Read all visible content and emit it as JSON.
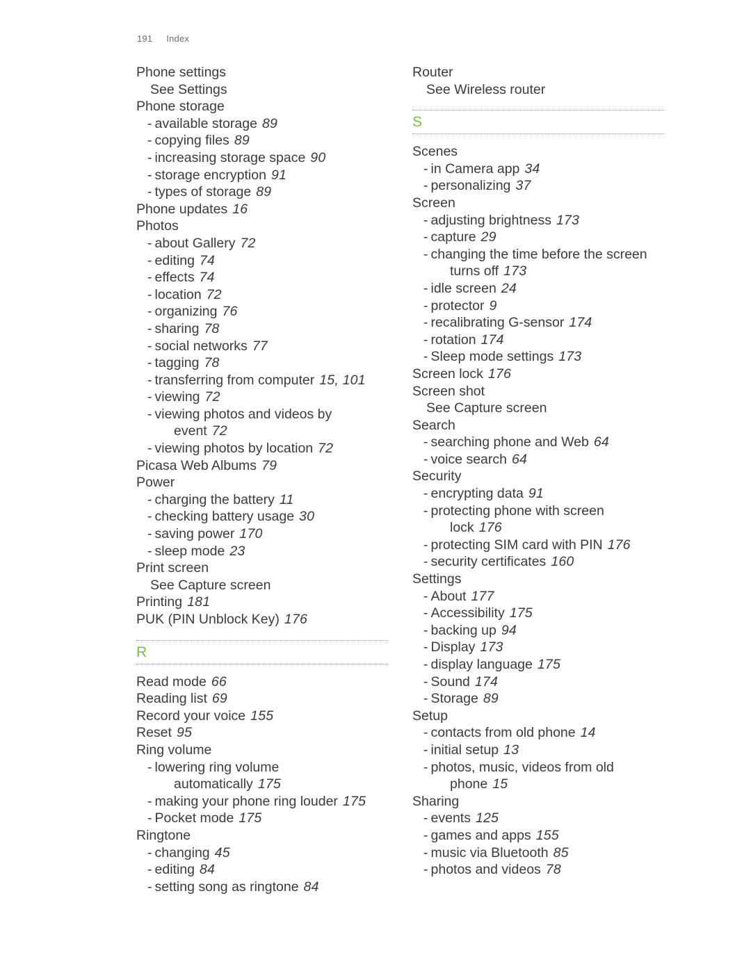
{
  "header": {
    "folio": "191",
    "title": "Index"
  },
  "colors": {
    "letter_green": "#78bf43",
    "text": "#3b3b3b",
    "header_text": "#6e6e6e",
    "rule": "#909090"
  },
  "left_column": [
    {
      "level": 0,
      "text": "Phone settings"
    },
    {
      "level": 2,
      "text": "See Settings"
    },
    {
      "level": 0,
      "text": "Phone storage"
    },
    {
      "level": 1,
      "text": "available storage",
      "page": "89"
    },
    {
      "level": 1,
      "text": "copying files",
      "page": "89"
    },
    {
      "level": 1,
      "text": "increasing storage space",
      "page": "90"
    },
    {
      "level": 1,
      "text": "storage encryption",
      "page": "91"
    },
    {
      "level": 1,
      "text": "types of storage",
      "page": "89"
    },
    {
      "level": 0,
      "text": "Phone updates",
      "page": "16"
    },
    {
      "level": 0,
      "text": "Photos"
    },
    {
      "level": 1,
      "text": "about Gallery",
      "page": "72"
    },
    {
      "level": 1,
      "text": "editing",
      "page": "74"
    },
    {
      "level": 1,
      "text": "effects",
      "page": "74"
    },
    {
      "level": 1,
      "text": "location",
      "page": "72"
    },
    {
      "level": 1,
      "text": "organizing",
      "page": "76"
    },
    {
      "level": 1,
      "text": "sharing",
      "page": "78"
    },
    {
      "level": 1,
      "text": "social networks",
      "page": "77"
    },
    {
      "level": 1,
      "text": "tagging",
      "page": "78"
    },
    {
      "level": 1,
      "text": "transferring from computer",
      "page": "15, 101"
    },
    {
      "level": 1,
      "text": "viewing",
      "page": "72"
    },
    {
      "level": 1,
      "text": "viewing photos and videos by"
    },
    {
      "level": 3,
      "text": "event",
      "page": "72"
    },
    {
      "level": 1,
      "text": "viewing photos by location",
      "page": "72"
    },
    {
      "level": 0,
      "text": "Picasa Web Albums",
      "page": "79"
    },
    {
      "level": 0,
      "text": "Power"
    },
    {
      "level": 1,
      "text": "charging the battery",
      "page": "11"
    },
    {
      "level": 1,
      "text": "checking battery usage",
      "page": "30"
    },
    {
      "level": 1,
      "text": "saving power",
      "page": "170"
    },
    {
      "level": 1,
      "text": "sleep mode",
      "page": "23"
    },
    {
      "level": 0,
      "text": "Print screen"
    },
    {
      "level": 2,
      "text": "See Capture screen"
    },
    {
      "level": 0,
      "text": "Printing",
      "page": "181"
    },
    {
      "level": 0,
      "text": "PUK (PIN Unblock Key)",
      "page": "176"
    },
    {
      "letter": "R"
    },
    {
      "level": 0,
      "text": "Read mode",
      "page": "66"
    },
    {
      "level": 0,
      "text": "Reading list",
      "page": "69"
    },
    {
      "level": 0,
      "text": "Record your voice",
      "page": "155"
    },
    {
      "level": 0,
      "text": "Reset",
      "page": "95"
    },
    {
      "level": 0,
      "text": "Ring volume"
    },
    {
      "level": 1,
      "text": "lowering ring volume"
    },
    {
      "level": 3,
      "text": "automatically",
      "page": "175"
    },
    {
      "level": 1,
      "text": "making your phone ring louder",
      "page": "175"
    },
    {
      "level": 1,
      "text": "Pocket mode",
      "page": "175"
    },
    {
      "level": 0,
      "text": "Ringtone"
    },
    {
      "level": 1,
      "text": "changing",
      "page": "45"
    },
    {
      "level": 1,
      "text": "editing",
      "page": "84"
    },
    {
      "level": 1,
      "text": "setting song as ringtone",
      "page": "84"
    }
  ],
  "right_column": [
    {
      "level": 0,
      "text": "Router"
    },
    {
      "level": 2,
      "text": "See Wireless router"
    },
    {
      "letter": "S"
    },
    {
      "level": 0,
      "text": "Scenes"
    },
    {
      "level": 1,
      "text": "in Camera app",
      "page": "34"
    },
    {
      "level": 1,
      "text": "personalizing",
      "page": "37"
    },
    {
      "level": 0,
      "text": "Screen"
    },
    {
      "level": 1,
      "text": "adjusting brightness",
      "page": "173"
    },
    {
      "level": 1,
      "text": "capture",
      "page": "29"
    },
    {
      "level": 1,
      "text": "changing the time before the screen"
    },
    {
      "level": 3,
      "text": "turns off",
      "page": "173"
    },
    {
      "level": 1,
      "text": "idle screen",
      "page": "24"
    },
    {
      "level": 1,
      "text": "protector",
      "page": "9"
    },
    {
      "level": 1,
      "text": "recalibrating G-sensor",
      "page": "174"
    },
    {
      "level": 1,
      "text": "rotation",
      "page": "174"
    },
    {
      "level": 1,
      "text": "Sleep mode settings",
      "page": "173"
    },
    {
      "level": 0,
      "text": "Screen lock",
      "page": "176"
    },
    {
      "level": 0,
      "text": "Screen shot"
    },
    {
      "level": 2,
      "text": "See Capture screen"
    },
    {
      "level": 0,
      "text": "Search"
    },
    {
      "level": 1,
      "text": "searching phone and Web",
      "page": "64"
    },
    {
      "level": 1,
      "text": "voice search",
      "page": "64"
    },
    {
      "level": 0,
      "text": "Security"
    },
    {
      "level": 1,
      "text": "encrypting data",
      "page": "91"
    },
    {
      "level": 1,
      "text": "protecting phone with screen"
    },
    {
      "level": 3,
      "text": "lock",
      "page": "176"
    },
    {
      "level": 1,
      "text": "protecting SIM card with PIN",
      "page": "176"
    },
    {
      "level": 1,
      "text": "security certificates",
      "page": "160"
    },
    {
      "level": 0,
      "text": "Settings"
    },
    {
      "level": 1,
      "text": "About",
      "page": "177"
    },
    {
      "level": 1,
      "text": "Accessibility",
      "page": "175"
    },
    {
      "level": 1,
      "text": "backing up",
      "page": "94"
    },
    {
      "level": 1,
      "text": "Display",
      "page": "173"
    },
    {
      "level": 1,
      "text": "display language",
      "page": "175"
    },
    {
      "level": 1,
      "text": "Sound",
      "page": "174"
    },
    {
      "level": 1,
      "text": "Storage",
      "page": "89"
    },
    {
      "level": 0,
      "text": "Setup"
    },
    {
      "level": 1,
      "text": "contacts from old phone",
      "page": "14"
    },
    {
      "level": 1,
      "text": "initial setup",
      "page": "13"
    },
    {
      "level": 1,
      "text": "photos, music, videos from old"
    },
    {
      "level": 3,
      "text": "phone",
      "page": "15"
    },
    {
      "level": 0,
      "text": "Sharing"
    },
    {
      "level": 1,
      "text": "events",
      "page": "125"
    },
    {
      "level": 1,
      "text": "games and apps",
      "page": "155"
    },
    {
      "level": 1,
      "text": "music via Bluetooth",
      "page": "85"
    },
    {
      "level": 1,
      "text": "photos and videos",
      "page": "78"
    }
  ]
}
